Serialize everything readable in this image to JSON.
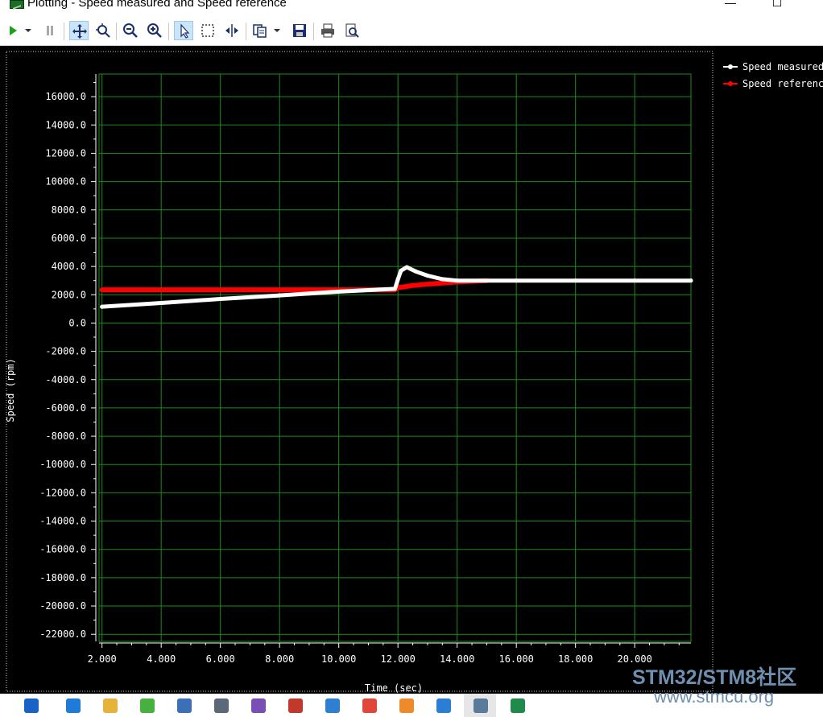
{
  "window": {
    "title": "Plotting  - Speed measured and Speed reference",
    "minimize": "—",
    "maximize": "☐"
  },
  "toolbar": {
    "items": [
      "run-icon",
      "run-dropdown-icon",
      "pause-icon",
      "pan-icon",
      "zoom-region-icon",
      "zoom-out-icon",
      "zoom-in-icon",
      "select-cursor-icon",
      "selection-box-icon",
      "split-axis-icon",
      "copy-icon",
      "copy-dropdown-icon",
      "save-icon",
      "print-icon",
      "print-preview-icon"
    ]
  },
  "chart_data": {
    "type": "line",
    "title": "",
    "xlabel": "Time (sec)",
    "ylabel": "Speed (rpm)",
    "xlim": [
      1.9,
      21.9
    ],
    "ylim": [
      -22500,
      17600
    ],
    "x_ticks": [
      2,
      4,
      6,
      8,
      10,
      12,
      14,
      16,
      18,
      20
    ],
    "x_tick_labels": [
      "2.000",
      "4.000",
      "6.000",
      "8.000",
      "10.000",
      "12.000",
      "14.000",
      "16.000",
      "18.000",
      "20.000"
    ],
    "y_ticks": [
      16000,
      14000,
      12000,
      10000,
      8000,
      6000,
      4000,
      2000,
      0,
      -2000,
      -4000,
      -6000,
      -8000,
      -10000,
      -12000,
      -14000,
      -16000,
      -18000,
      -20000,
      -22000
    ],
    "y_tick_labels": [
      "16000.0",
      "14000.0",
      "12000.0",
      "10000.0",
      "8000.0",
      "6000.0",
      "4000.0",
      "2000.0",
      "0.0",
      "-2000.0",
      "-4000.0",
      "-6000.0",
      "-8000.0",
      "-10000.0",
      "-12000.0",
      "-14000.0",
      "-16000.0",
      "-18000.0",
      "-20000.0",
      "-22000.0"
    ],
    "grid": true,
    "legend_position": "top-right outside",
    "series": [
      {
        "name": "Speed measured",
        "color": "#ffffff",
        "x": [
          2.0,
          4.0,
          6.0,
          8.0,
          10.0,
          11.9,
          12.0,
          12.1,
          12.3,
          12.6,
          13.0,
          13.5,
          14.0,
          16.0,
          18.0,
          20.0,
          21.9
        ],
        "y": [
          1150,
          1420,
          1700,
          1950,
          2220,
          2420,
          3100,
          3700,
          3950,
          3650,
          3350,
          3100,
          3000,
          3000,
          3000,
          3000,
          3000
        ]
      },
      {
        "name": "Speed reference",
        "color": "#ff0000",
        "x": [
          2.0,
          4.0,
          6.0,
          8.0,
          10.0,
          11.9,
          12.0,
          12.5,
          13.0,
          14.0,
          15.0
        ],
        "y": [
          2350,
          2350,
          2350,
          2350,
          2350,
          2350,
          2500,
          2650,
          2750,
          2900,
          3000
        ]
      }
    ]
  },
  "taskbar": {
    "items": [
      {
        "name": "ie-icon",
        "color": "#1a63c6"
      },
      {
        "name": "edge-icon",
        "color": "#1f7bd6"
      },
      {
        "name": "file-explorer-icon",
        "color": "#e6b23a"
      },
      {
        "name": "browser-360-icon",
        "color": "#47b03f"
      },
      {
        "name": "store-icon",
        "color": "#3b6fb8"
      },
      {
        "name": "notification-app-icon",
        "color": "#5c6778"
      },
      {
        "name": "visual-studio-icon",
        "color": "#7a4fb5"
      },
      {
        "name": "snipping-tool-icon",
        "color": "#c0392b"
      },
      {
        "name": "app-a-icon",
        "color": "#2f7fd0"
      },
      {
        "name": "chrome-icon",
        "color": "#e0473b"
      },
      {
        "name": "foxmail-icon",
        "color": "#ef8a2a"
      },
      {
        "name": "blue-bird-icon",
        "color": "#2a7fd4"
      },
      {
        "name": "motor-gui-icon",
        "color": "#5a7a9a"
      },
      {
        "name": "excel-app-icon",
        "color": "#1f8a4c"
      }
    ]
  },
  "watermark": {
    "main": "STM32/STM8社区",
    "sub": "www.stmcu.org"
  }
}
